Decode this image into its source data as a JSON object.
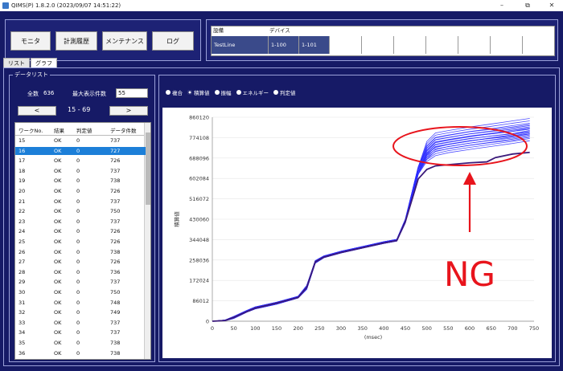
{
  "window": {
    "title": "QIMS(P) 1.8.2.0 (2023/09/07 14:51:22)",
    "minimize": "–",
    "restore": "⧉",
    "close": "✕"
  },
  "nav": {
    "monitor": "モニタ",
    "history": "計測履歴",
    "maintenance": "メンテナンス",
    "log": "ログ"
  },
  "device": {
    "col_equipment": "設備",
    "col_device": "デバイス",
    "line": "TestLine",
    "dev1": "1-100",
    "dev2": "1-101"
  },
  "tabs": {
    "list": "リスト",
    "graph": "グラフ"
  },
  "datalist": {
    "title": "データリスト",
    "total_label": "全数",
    "total": "636",
    "max_label": "最大表示件数",
    "max_value": "55",
    "prev": "<",
    "next": ">",
    "range": "15  -  69",
    "headers": {
      "no": "ワークNo.",
      "result": "結果",
      "judge": "判定値",
      "count": "データ件数"
    },
    "rows": [
      [
        "15",
        "OK",
        "0",
        "737"
      ],
      [
        "16",
        "OK",
        "0",
        "727"
      ],
      [
        "17",
        "OK",
        "0",
        "726"
      ],
      [
        "18",
        "OK",
        "0",
        "737"
      ],
      [
        "19",
        "OK",
        "0",
        "738"
      ],
      [
        "20",
        "OK",
        "0",
        "726"
      ],
      [
        "21",
        "OK",
        "0",
        "737"
      ],
      [
        "22",
        "OK",
        "0",
        "750"
      ],
      [
        "23",
        "OK",
        "0",
        "737"
      ],
      [
        "24",
        "OK",
        "0",
        "726"
      ],
      [
        "25",
        "OK",
        "0",
        "726"
      ],
      [
        "26",
        "OK",
        "0",
        "738"
      ],
      [
        "27",
        "OK",
        "0",
        "726"
      ],
      [
        "28",
        "OK",
        "0",
        "736"
      ],
      [
        "29",
        "OK",
        "0",
        "737"
      ],
      [
        "30",
        "OK",
        "0",
        "750"
      ],
      [
        "31",
        "OK",
        "0",
        "748"
      ],
      [
        "32",
        "OK",
        "0",
        "749"
      ],
      [
        "33",
        "OK",
        "0",
        "737"
      ],
      [
        "34",
        "OK",
        "0",
        "737"
      ],
      [
        "35",
        "OK",
        "0",
        "738"
      ],
      [
        "36",
        "OK",
        "0",
        "738"
      ]
    ],
    "selected_index": 1
  },
  "graph_options": [
    "複合",
    "積算値",
    "振幅",
    "エネルギー",
    "判定値"
  ],
  "graph_selected": 1,
  "annotation": {
    "text": "NG",
    "color": "#e8141c"
  },
  "colors": {
    "series": "#2b2bff",
    "ng": "#3b1a7a"
  },
  "chart_data": {
    "type": "line",
    "xlabel": "(msec)",
    "ylabel": "積算値",
    "xlim": [
      0,
      750
    ],
    "ylim": [
      0,
      860120
    ],
    "xticks": [
      0,
      50,
      100,
      150,
      200,
      250,
      300,
      350,
      400,
      450,
      500,
      550,
      600,
      650,
      700,
      750
    ],
    "yticks": [
      0,
      86012,
      172024,
      258036,
      344048,
      430060,
      516072,
      602084,
      688096,
      774108,
      860120
    ],
    "series": [
      {
        "x": [
          0,
          30,
          50,
          80,
          100,
          150,
          200,
          220,
          240,
          260,
          300,
          350,
          400,
          430,
          450,
          480,
          500,
          520,
          550,
          600,
          650,
          700,
          740
        ],
        "y": [
          0,
          5000,
          20000,
          45000,
          60000,
          80000,
          105000,
          150000,
          255000,
          275000,
          295000,
          315000,
          335000,
          345000,
          430000,
          650000,
          740000,
          775000,
          785000,
          800000,
          812000,
          825000,
          835000
        ]
      },
      {
        "x": [
          0,
          30,
          50,
          80,
          100,
          150,
          200,
          220,
          240,
          260,
          300,
          350,
          400,
          430,
          450,
          480,
          500,
          520,
          550,
          600,
          650,
          700,
          740
        ],
        "y": [
          0,
          3000,
          15000,
          40000,
          55000,
          75000,
          100000,
          140000,
          250000,
          270000,
          290000,
          310000,
          330000,
          340000,
          420000,
          640000,
          720000,
          755000,
          765000,
          780000,
          790000,
          800000,
          810000
        ]
      },
      {
        "x": [
          0,
          30,
          50,
          80,
          100,
          150,
          200,
          220,
          240,
          260,
          300,
          350,
          400,
          430,
          450,
          480,
          500,
          520,
          550,
          600,
          650,
          700,
          740
        ],
        "y": [
          0,
          4000,
          18000,
          42000,
          58000,
          78000,
          102000,
          145000,
          252000,
          272000,
          292000,
          312000,
          332000,
          342000,
          425000,
          630000,
          700000,
          735000,
          745000,
          760000,
          772000,
          782000,
          795000
        ]
      },
      {
        "x": [
          0,
          30,
          50,
          80,
          100,
          150,
          200,
          220,
          240,
          260,
          300,
          350,
          400,
          430,
          450,
          480,
          500,
          520,
          550,
          600,
          650,
          700,
          740
        ],
        "y": [
          0,
          2000,
          12000,
          38000,
          52000,
          72000,
          98000,
          135000,
          245000,
          268000,
          288000,
          308000,
          328000,
          338000,
          415000,
          620000,
          690000,
          715000,
          728000,
          742000,
          755000,
          768000,
          780000
        ]
      }
    ],
    "ng_series": {
      "x": [
        0,
        30,
        50,
        80,
        100,
        150,
        200,
        220,
        240,
        260,
        300,
        350,
        400,
        430,
        450,
        480,
        500,
        520,
        550,
        600,
        640,
        660,
        700,
        740
      ],
      "y": [
        0,
        3000,
        16000,
        40000,
        55000,
        76000,
        100000,
        142000,
        250000,
        270000,
        290000,
        310000,
        330000,
        340000,
        420000,
        600000,
        640000,
        655000,
        660000,
        668000,
        672000,
        690000,
        705000,
        712000
      ]
    }
  }
}
